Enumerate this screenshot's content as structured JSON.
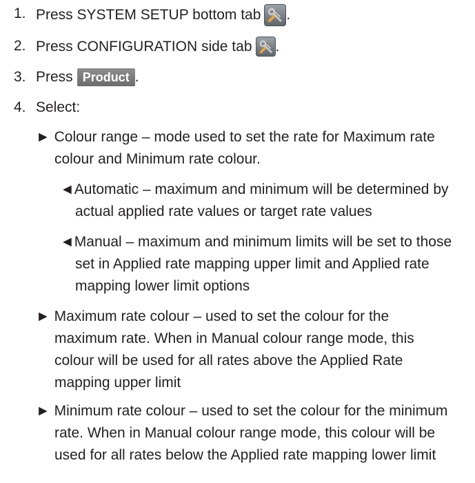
{
  "steps": [
    {
      "num": "1.",
      "text": "Press SYSTEM SETUP bottom tab",
      "suffix": "."
    },
    {
      "num": "2.",
      "text": "Press CONFIGURATION side tab",
      "suffix": "."
    },
    {
      "num": "3.",
      "text": "Press",
      "button": "Product",
      "suffix": "."
    },
    {
      "num": "4.",
      "text": "Select:"
    }
  ],
  "bullets": {
    "colour_range": {
      "marker": "►",
      "lines": [
        "Colour range – mode used to set the rate for Maximum rate",
        "colour and Minimum rate colour."
      ]
    },
    "automatic": {
      "marker": "◄",
      "lines": [
        "Automatic – maximum and minimum will be determined by",
        "actual applied rate values or target rate values"
      ]
    },
    "manual": {
      "marker": "◄",
      "lines": [
        "Manual – maximum and minimum limits will be set to those",
        "set in Applied rate mapping upper limit and Applied rate",
        "mapping lower limit options"
      ]
    },
    "maximum": {
      "marker": "►",
      "lines": [
        "Maximum rate colour – used to set the colour for the",
        "maximum rate. When in Manual colour range mode, this",
        "colour will be used for all rates above the Applied Rate",
        "mapping upper limit"
      ]
    },
    "minimum": {
      "marker": "►",
      "lines": [
        "Minimum rate colour – used to set the colour for the minimum",
        "rate. When in Manual colour range mode, this colour will be",
        "used for all rates below the Applied rate mapping lower limit"
      ]
    }
  },
  "icons": {
    "setup_tab": "tools-icon",
    "config_tab": "tools-icon"
  }
}
